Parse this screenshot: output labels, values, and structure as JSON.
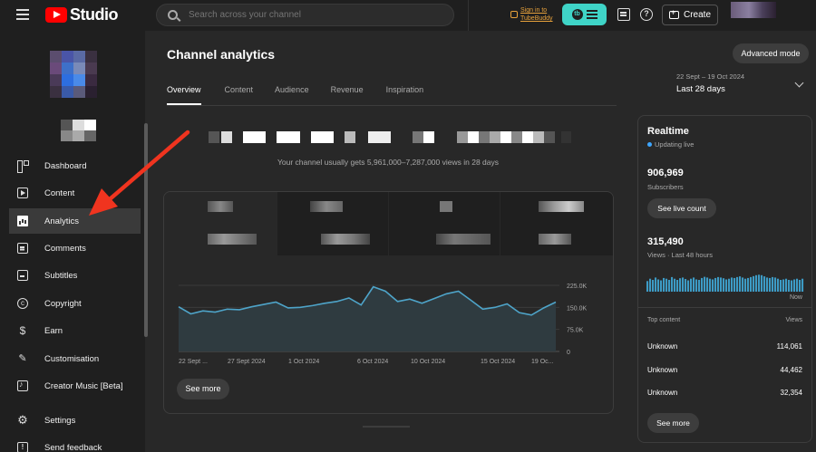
{
  "header": {
    "logo_text": "Studio",
    "search_placeholder": "Search across your channel",
    "tubebuddy_line1": "Sign in to",
    "tubebuddy_line2": "TubeBuddy",
    "create_label": "Create"
  },
  "sidebar": {
    "items": [
      {
        "label": "Dashboard"
      },
      {
        "label": "Content"
      },
      {
        "label": "Analytics"
      },
      {
        "label": "Comments"
      },
      {
        "label": "Subtitles"
      },
      {
        "label": "Copyright"
      },
      {
        "label": "Earn"
      },
      {
        "label": "Customisation"
      },
      {
        "label": "Creator Music [Beta]"
      },
      {
        "label": "Settings"
      },
      {
        "label": "Send feedback"
      }
    ],
    "active": "Analytics"
  },
  "main": {
    "title": "Channel analytics",
    "tabs": [
      {
        "label": "Overview"
      },
      {
        "label": "Content"
      },
      {
        "label": "Audience"
      },
      {
        "label": "Revenue"
      },
      {
        "label": "Inspiration"
      }
    ],
    "advanced_mode": "Advanced mode",
    "date_range_sub": "22 Sept – 19 Oct 2024",
    "date_range_main": "Last 28 days",
    "views_info": "Your channel usually gets 5,961,000–7,287,000 views in 28 days",
    "see_more": "See more"
  },
  "chart_data": {
    "type": "area",
    "x_tick_labels": [
      "22 Sept ...",
      "27 Sept 2024",
      "1 Oct 2024",
      "6 Oct 2024",
      "10 Oct 2024",
      "15 Oct 2024",
      "19 Oc..."
    ],
    "y_tick_labels": [
      "225.0K",
      "150.0K",
      "75.0K",
      "0"
    ],
    "ylim": [
      0,
      225000
    ],
    "values": [
      152000,
      128000,
      138000,
      134000,
      144000,
      142000,
      152000,
      160000,
      168000,
      148000,
      150000,
      156000,
      164000,
      170000,
      182000,
      158000,
      220000,
      205000,
      170000,
      178000,
      164000,
      180000,
      196000,
      205000,
      175000,
      144000,
      150000,
      162000,
      132000,
      124000,
      148000,
      168000
    ],
    "line_color": "#4ea4c9",
    "fill_color": "#2f3b40",
    "grid": true
  },
  "realtime": {
    "title": "Realtime",
    "status": "Updating live",
    "subscribers": "906,969",
    "subscribers_label": "Subscribers",
    "live_count": "See live count",
    "views": "315,490",
    "views_label": "Views · Last 48 hours",
    "now_label": "Now",
    "bar_values": [
      0.45,
      0.55,
      0.5,
      0.6,
      0.52,
      0.48,
      0.58,
      0.55,
      0.5,
      0.62,
      0.55,
      0.5,
      0.57,
      0.6,
      0.54,
      0.48,
      0.55,
      0.6,
      0.52,
      0.5,
      0.58,
      0.63,
      0.6,
      0.55,
      0.52,
      0.58,
      0.62,
      0.6,
      0.57,
      0.52,
      0.55,
      0.6,
      0.58,
      0.62,
      0.65,
      0.6,
      0.55,
      0.58,
      0.62,
      0.66,
      0.7,
      0.72,
      0.7,
      0.65,
      0.6,
      0.58,
      0.62,
      0.6,
      0.55,
      0.5,
      0.52,
      0.55,
      0.5,
      0.48,
      0.52,
      0.55,
      0.5,
      0.55
    ],
    "bar_color": "#3d9bc5",
    "top_content_label": "Top content",
    "views_col_label": "Views",
    "rows": [
      {
        "name": "Unknown",
        "views": "114,061"
      },
      {
        "name": "Unknown",
        "views": "44,462"
      },
      {
        "name": "Unknown",
        "views": "32,354"
      }
    ],
    "see_more": "See more"
  }
}
